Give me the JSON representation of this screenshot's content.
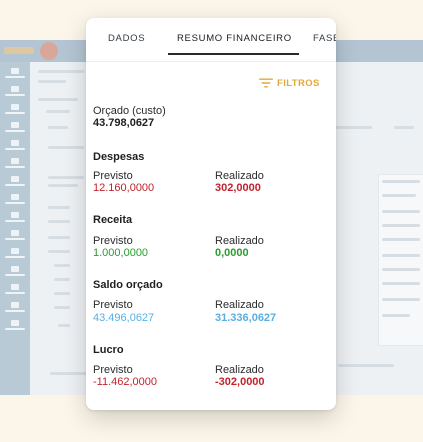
{
  "colors": {
    "accent": "#e3a83a",
    "negative": "#c0232c",
    "positive": "#2a9d2f",
    "info": "#5aaee0",
    "background": "#fcf6ea"
  },
  "tabs": [
    {
      "label": "DADOS",
      "active": false
    },
    {
      "label": "RESUMO FINANCEIRO",
      "active": true
    },
    {
      "label": "FASE",
      "active": false
    }
  ],
  "filters": {
    "icon": "filter-lines-icon",
    "label": "FILTROS"
  },
  "budget": {
    "label": "Orçado (custo)",
    "value": "43.798,0627"
  },
  "sections": {
    "despesas": {
      "title": "Despesas",
      "forecast_label": "Previsto",
      "forecast_value": "12.160,0000",
      "actual_label": "Realizado",
      "actual_value": "302,0000"
    },
    "receita": {
      "title": "Receita",
      "forecast_label": "Previsto",
      "forecast_value": "1.000,0000",
      "actual_label": "Realizado",
      "actual_value": "0,0000"
    },
    "saldo": {
      "title": "Saldo orçado",
      "forecast_label": "Previsto",
      "forecast_value": "43.496,0627",
      "actual_label": "Realizado",
      "actual_value": "31.336,0627"
    },
    "lucro": {
      "title": "Lucro",
      "forecast_label": "Previsto",
      "forecast_value": "-11.462,0000",
      "actual_label": "Realizado",
      "actual_value": "-302,0000"
    }
  }
}
